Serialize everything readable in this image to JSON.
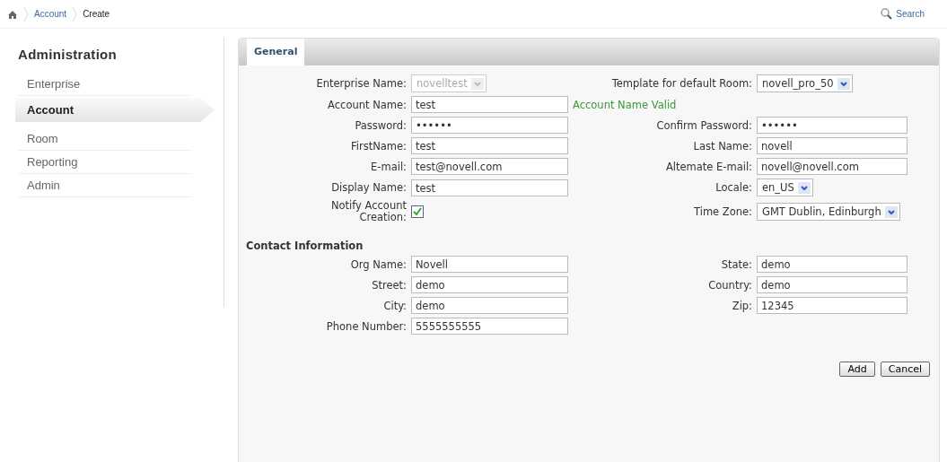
{
  "breadcrumb": [
    {
      "kind": "home"
    },
    {
      "kind": "link",
      "label": "Account"
    },
    {
      "kind": "current",
      "label": "Create"
    }
  ],
  "search": {
    "label": "Search"
  },
  "sidebar": {
    "title": "Administration",
    "items": [
      {
        "label": "Enterprise",
        "selected": false
      },
      {
        "label": "Account",
        "selected": true
      },
      {
        "label": "Room",
        "selected": false
      },
      {
        "label": "Reporting",
        "selected": false
      },
      {
        "label": "Admin",
        "selected": false
      }
    ]
  },
  "tabs": [
    {
      "label": "General",
      "selected": true
    }
  ],
  "form": {
    "rows": [
      {
        "left": {
          "kind": "select",
          "label": "Enterprise Name:",
          "value": "novelltest",
          "disabled": true
        },
        "right": {
          "kind": "select",
          "label": "Template for default Room:",
          "value": "novell_pro_50",
          "disabled": false
        }
      },
      {
        "left": {
          "kind": "text",
          "label": "Account Name:",
          "value": "test"
        },
        "right": {
          "kind": "message",
          "text": "Account Name Valid"
        }
      },
      {
        "left": {
          "kind": "password",
          "label": "Password:",
          "value": "••••••"
        },
        "right": {
          "kind": "password",
          "label": "Confirm Password:",
          "value": "••••••"
        }
      },
      {
        "left": {
          "kind": "text",
          "label": "FirstName:",
          "value": "test"
        },
        "right": {
          "kind": "text",
          "label": "Last Name:",
          "value": "novell"
        }
      },
      {
        "left": {
          "kind": "text",
          "label": "E-mail:",
          "value": "test@novell.com"
        },
        "right": {
          "kind": "text",
          "label": "Altemate E-mail:",
          "value": "novell@novell.com"
        }
      },
      {
        "left": {
          "kind": "text",
          "label": "Display Name:",
          "value": "test"
        },
        "right": {
          "kind": "select",
          "label": "Locale:",
          "value": "en_US",
          "disabled": false
        }
      },
      {
        "left": {
          "kind": "checkbox",
          "label": "Notify Account Creation:",
          "checked": true
        },
        "right": {
          "kind": "select",
          "label": "Time Zone:",
          "value": "GMT Dublin, Edinburgh",
          "disabled": false
        }
      }
    ]
  },
  "contact": {
    "title": "Contact Information",
    "rows": [
      {
        "left": {
          "kind": "text",
          "label": "Org Name:",
          "value": "Novell"
        },
        "right": {
          "kind": "text",
          "label": "State:",
          "value": "demo"
        }
      },
      {
        "left": {
          "kind": "text",
          "label": "Street:",
          "value": "demo"
        },
        "right": {
          "kind": "text",
          "label": "Country:",
          "value": "demo"
        }
      },
      {
        "left": {
          "kind": "text",
          "label": "City:",
          "value": "demo"
        },
        "right": {
          "kind": "text",
          "label": "Zip:",
          "value": "12345"
        }
      },
      {
        "left": {
          "kind": "text",
          "label": "Phone Number:",
          "value": "5555555555"
        }
      }
    ]
  },
  "buttons": [
    "Add",
    "Cancel"
  ]
}
